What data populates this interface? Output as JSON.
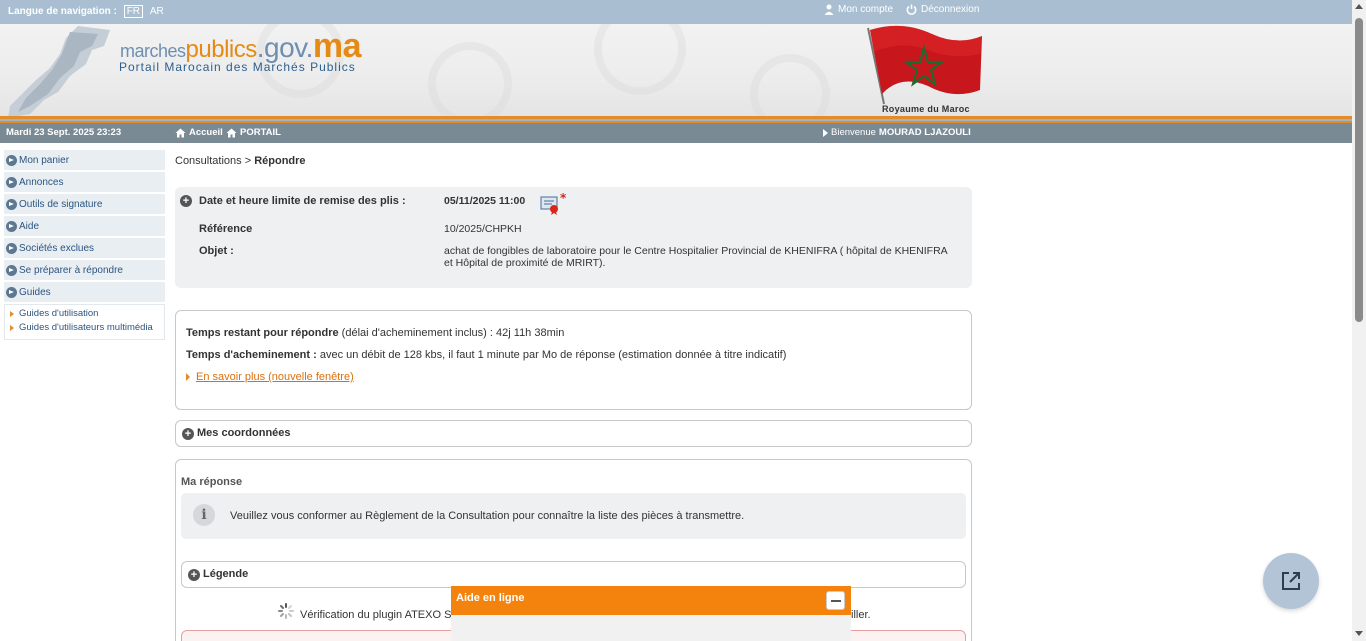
{
  "topbar": {
    "lang_label": "Langue de navigation :",
    "lang_fr": "FR",
    "lang_ar": "AR",
    "account": "Mon compte",
    "logout": "Déconnexion"
  },
  "banner": {
    "logo_part1": "marches",
    "logo_part2": "publics",
    "logo_part3": ".gov.",
    "logo_part4": "ma",
    "subtitle": "Portail Marocain des Marchés Publics",
    "royaume": "Royaume du Maroc"
  },
  "navbar": {
    "date": "Mardi 23 Sept. 2025 23:23",
    "home": "Accueil",
    "portail": "PORTAIL",
    "welcome_prefix": "Bienvenue",
    "user": "MOURAD LJAZOULI"
  },
  "sidebar": {
    "items": [
      {
        "label": "Mon panier"
      },
      {
        "label": "Annonces"
      },
      {
        "label": "Outils de signature"
      },
      {
        "label": "Aide"
      },
      {
        "label": "Sociétés exclues"
      },
      {
        "label": "Se préparer à répondre"
      },
      {
        "label": "Guides"
      }
    ],
    "subitems": [
      {
        "label": "Guides d'utilisation"
      },
      {
        "label": "Guides d'utilisateurs multimédia"
      }
    ]
  },
  "breadcrumb": {
    "parent": "Consultations >",
    "current": "Répondre"
  },
  "consultation": {
    "deadline_label": "Date et heure limite de remise des plis :",
    "deadline_value": "05/11/2025 11:00",
    "reference_label": "Référence",
    "reference_value": "10/2025/CHPKH",
    "objet_label": "Objet :",
    "objet_value": "achat de fongibles de laboratoire pour le Centre Hospitalier Provincial de KHENIFRA ( hôpital de KHENIFRA et Hôpital de proximité de MRIRT)."
  },
  "timing": {
    "remaining_label": "Temps restant pour répondre",
    "remaining_note": "(délai d'acheminement inclus) :",
    "remaining_value": "42j 11h 38min",
    "transit_label": "Temps d'acheminement :",
    "transit_value": "avec un débit de 128 kbs, il faut 1 minute par Mo de réponse (estimation donnée à titre indicatif)",
    "more_link": "En savoir plus (nouvelle fenêtre)"
  },
  "coordonnees": {
    "title": "Mes coordonnées"
  },
  "reponse": {
    "title": "Ma réponse",
    "info": "Veuillez vous conformer au Règlement de la Consultation pour connaître la liste des pièces à transmettre.",
    "legend": "Légende",
    "plugin_start": "Vérification du plugin ATEXO S",
    "plugin_end": "iller."
  },
  "aide_en_ligne": {
    "title": "Aide en ligne"
  },
  "colors": {
    "topbar": "#a9bfd1",
    "navbar": "#7a8a95",
    "accent_orange": "#f4830d",
    "link_blue": "#2b5580"
  }
}
